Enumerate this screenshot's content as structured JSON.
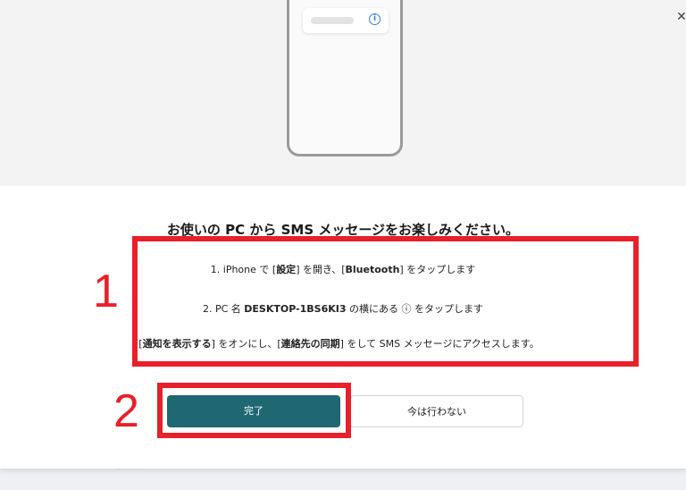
{
  "dialog": {
    "close_label": "✕",
    "title": "お使いの PC から SMS メッセージをお楽しみください。",
    "phone_mock": {
      "info_glyph": "i"
    },
    "steps": [
      {
        "prefix": "1. iPhone で [",
        "bold1": "設定",
        "middle": "] を開き、[",
        "bold2": "Bluetooth",
        "suffix": "] をタップします"
      },
      {
        "prefix": "2. PC 名 ",
        "bold1": "DESKTOP-1BS6KI3",
        "suffix": " の横にある ⓘ をタップします"
      },
      {
        "prefix": ". [",
        "bold1": "通知を表示する",
        "middle": "] をオンにし、[",
        "bold2": "連絡先の同期",
        "suffix": "] をして SMS メッセージにアクセスします。"
      }
    ],
    "buttons": {
      "done": "完了",
      "not_now": "今は行わない"
    }
  },
  "annotations": {
    "label1": "1",
    "label2": "2",
    "highlight_color": "#e8202a"
  },
  "colors": {
    "primary_button": "#1f6873",
    "info_icon": "#2f7fd6"
  }
}
